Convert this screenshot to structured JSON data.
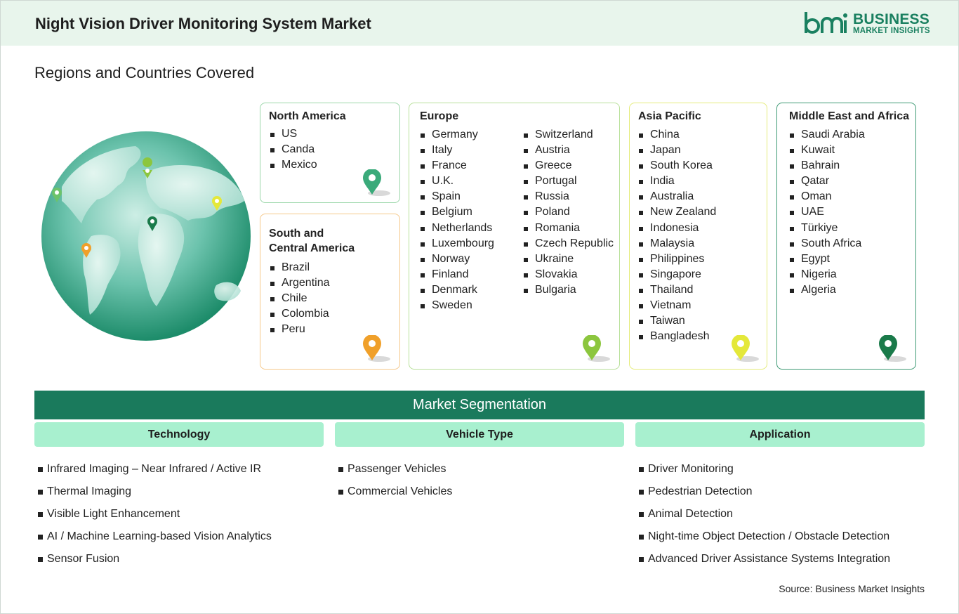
{
  "header": {
    "title": "Night Vision Driver Monitoring System Market",
    "logo": {
      "line1": "BUSINESS",
      "line2": "MARKET INSIGHTS",
      "color": "#1a8060"
    }
  },
  "subtitle": "Regions and Countries Covered",
  "regions": {
    "north_america": {
      "title": "North America",
      "items": [
        "US",
        "Canda",
        "Mexico"
      ],
      "pin_color": "#3aaa7a"
    },
    "south_central_america": {
      "title_line1": "South and",
      "title_line2": "Central America",
      "items": [
        "Brazil",
        "Argentina",
        "Chile",
        "Colombia",
        "Peru"
      ],
      "pin_color": "#f0a02a"
    },
    "europe": {
      "title": "Europe",
      "col1": [
        "Germany",
        "Italy",
        "France",
        "U.K.",
        "Spain",
        "Belgium",
        "Netherlands",
        "Luxembourg",
        "Norway",
        "Finland",
        "Denmark",
        "Sweden"
      ],
      "col2": [
        "Switzerland",
        "Austria",
        "Greece",
        "Portugal",
        "Russia",
        "Poland",
        "Romania",
        "Czech Republic",
        "Ukraine",
        "Slovakia",
        "Bulgaria"
      ],
      "pin_color": "#8cc63e"
    },
    "asia_pacific": {
      "title": "Asia Pacific",
      "items": [
        "China",
        "Japan",
        "South Korea",
        "India",
        "Australia",
        "New Zealand",
        "Indonesia",
        "Malaysia",
        "Philippines",
        "Singapore",
        "Thailand",
        "Vietnam",
        "Taiwan",
        "Bangladesh"
      ],
      "pin_color": "#e4e83a"
    },
    "middle_east_africa": {
      "title": "Middle East and Africa",
      "items": [
        "Saudi Arabia",
        "Kuwait",
        "Bahrain",
        "Qatar",
        "Oman",
        "UAE",
        "Türkiye",
        "South Africa",
        "Egypt",
        "Nigeria",
        "Algeria"
      ],
      "pin_color": "#1a7a4a"
    }
  },
  "segmentation": {
    "title": "Market Segmentation",
    "technology": {
      "title": "Technology",
      "items": [
        "Infrared Imaging – Near Infrared / Active IR",
        "Thermal Imaging",
        "Visible Light Enhancement",
        "AI / Machine Learning-based Vision Analytics",
        "Sensor Fusion"
      ]
    },
    "vehicle_type": {
      "title": "Vehicle Type",
      "items": [
        "Passenger Vehicles",
        "Commercial Vehicles"
      ]
    },
    "application": {
      "title": "Application",
      "items": [
        "Driver Monitoring",
        "Pedestrian Detection",
        "Animal Detection",
        "Night-time Object Detection / Obstacle Detection",
        "Advanced Driver Assistance Systems Integration"
      ]
    }
  },
  "source": "Source: Business Market Insights"
}
